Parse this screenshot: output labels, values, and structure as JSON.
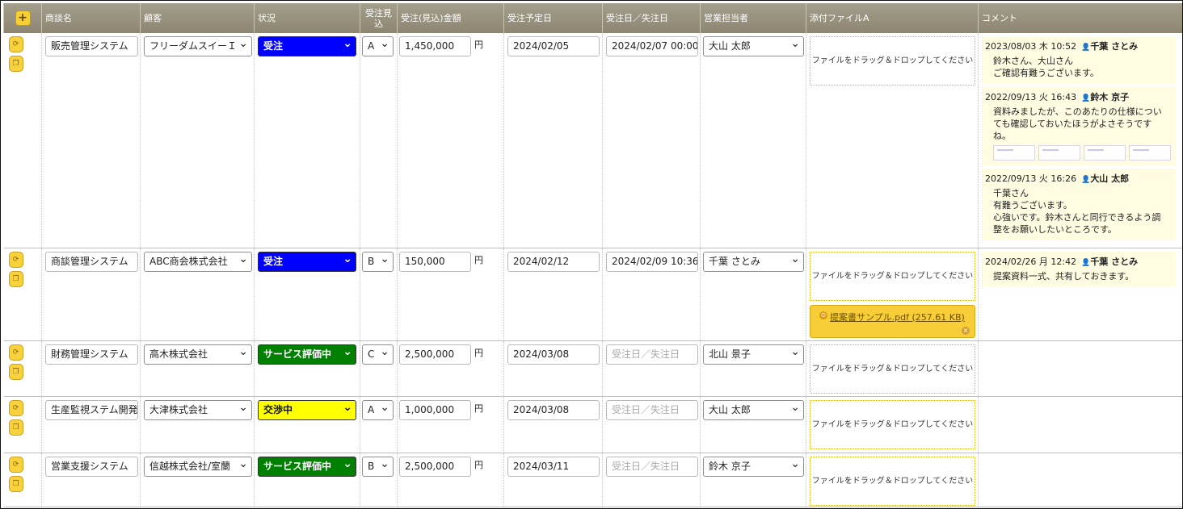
{
  "header": {
    "add": "+",
    "cols": [
      "商談名",
      "顧客",
      "状況",
      "受注見込",
      "受注(見込)金額",
      "受注予定日",
      "受注日／失注日",
      "営業担当者",
      "添付ファイルA",
      "コメント"
    ]
  },
  "common": {
    "yen": "円",
    "drop_text": "ファイルをドラッグ＆ドロップしてください",
    "closed_placeholder": "受注日／失注日"
  },
  "colors": {
    "won": "#0000ff",
    "evaluating": "#008000",
    "negotiating": "#ffff00",
    "accent": "#f6cf37"
  },
  "rows": [
    {
      "name": "販売管理システム",
      "customer": "フリーダムスイーＩ",
      "status": "受注",
      "status_color": "#0000ff",
      "prob": "A",
      "amount": "1,450,000",
      "planned": "2024/02/05",
      "closed": "2024/02/07 00:00:(",
      "rep": "大山 太郎",
      "comments": [
        {
          "ts": "2023/08/03 木 10:52",
          "user": "千葉 さとみ",
          "text": "鈴木さん、大山さん\nご確認有難うございます。"
        },
        {
          "ts": "2022/09/13 火 16:43",
          "user": "鈴木 京子",
          "text": "資料みましたが、このあたりの仕様につい\nても確認しておいたほうがよさそうです\nね。",
          "thumbs": true
        },
        {
          "ts": "2022/09/13 火 16:26",
          "user": "大山 太郎",
          "text": "千葉さん\n有難うございます。\n心強いです。鈴木さんと同行できるよう調\n整をお願いしたいところです。"
        }
      ]
    },
    {
      "name": "商談管理システム",
      "customer": "ABC商会株式会社",
      "status": "受注",
      "status_color": "#0000ff",
      "prob": "B",
      "amount": "150,000",
      "planned": "2024/02/12",
      "closed": "2024/02/09 10:36:3",
      "rep": "千葉 さとみ",
      "file": "提案書サンプル.pdf (257.61 KB)",
      "comments": [
        {
          "ts": "2024/02/26 月 12:42",
          "user": "千葉 さとみ",
          "text": "提案資料一式、共有しておきます。"
        }
      ]
    },
    {
      "name": "財務管理システム",
      "customer": "高木株式会社",
      "status": "サービス評価中",
      "status_color": "#008000",
      "prob": "C",
      "amount": "2,500,000",
      "planned": "2024/03/08",
      "closed": "",
      "rep": "北山 景子",
      "comments": []
    },
    {
      "name": "生産監視ステム開発",
      "customer": "大津株式会社",
      "status": "交渉中",
      "status_color": "#ffff00",
      "prob": "A",
      "amount": "1,000,000",
      "planned": "2024/03/08",
      "closed": "",
      "rep": "大山 太郎",
      "comments": []
    },
    {
      "name": "営業支援システム",
      "customer": "信越株式会社/室蘭",
      "status": "サービス評価中",
      "status_color": "#008000",
      "prob": "B",
      "amount": "2,500,000",
      "planned": "2024/03/11",
      "closed": "",
      "rep": "鈴木 京子",
      "comments": []
    }
  ]
}
